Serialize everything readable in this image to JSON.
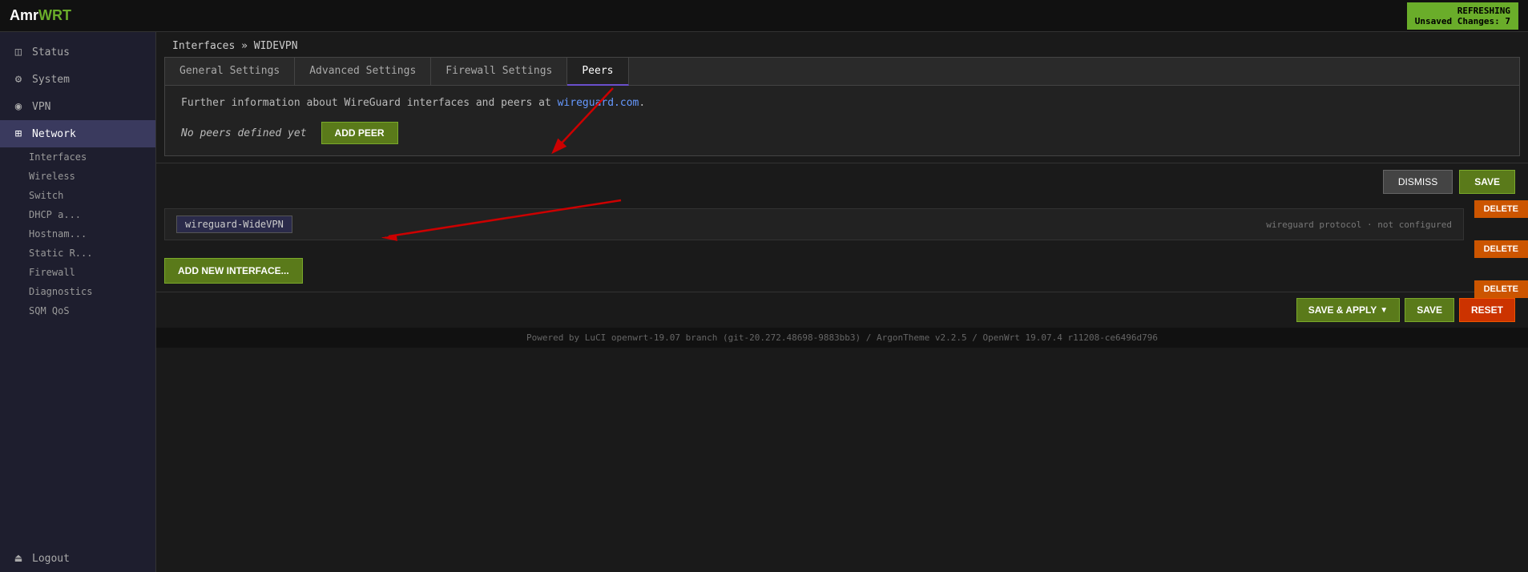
{
  "topbar": {
    "logo_amr": "Amr",
    "logo_wrt": "WRT",
    "refresh_label": "REFRESHING",
    "unsaved_label": "Unsaved Changes: 7"
  },
  "sidebar": {
    "items": [
      {
        "id": "status",
        "label": "Status",
        "icon": "◫"
      },
      {
        "id": "system",
        "label": "System",
        "icon": "⚙"
      },
      {
        "id": "vpn",
        "label": "VPN",
        "icon": "◉"
      },
      {
        "id": "network",
        "label": "Network",
        "icon": "⊞",
        "active": true
      }
    ],
    "sub_items": [
      {
        "id": "interfaces",
        "label": "Interfaces"
      },
      {
        "id": "wireless",
        "label": "Wireless"
      },
      {
        "id": "switch",
        "label": "Switch"
      },
      {
        "id": "dhcp",
        "label": "DHCP a..."
      },
      {
        "id": "hostnames",
        "label": "Hostnam..."
      },
      {
        "id": "static_routes",
        "label": "Static R..."
      },
      {
        "id": "firewall",
        "label": "Firewall"
      },
      {
        "id": "diagnostics",
        "label": "Diagnostics"
      },
      {
        "id": "sqm",
        "label": "SQM QoS"
      }
    ],
    "logout": "Logout"
  },
  "breadcrumb": {
    "parent": "Interfaces",
    "separator": "»",
    "current": "WIDEVPN"
  },
  "tabs": [
    {
      "id": "general",
      "label": "General Settings"
    },
    {
      "id": "advanced",
      "label": "Advanced Settings",
      "active": false
    },
    {
      "id": "firewall",
      "label": "Firewall Settings"
    },
    {
      "id": "peers",
      "label": "Peers",
      "active": true
    }
  ],
  "info_text": {
    "prefix": "Further information about WireGuard interfaces and peers at",
    "link_text": "wireguard.com",
    "link_url": "https://wireguard.com",
    "suffix": "."
  },
  "peers": {
    "no_peers_text": "No peers defined yet",
    "add_peer_label": "ADD PEER"
  },
  "interface_row": {
    "name": "wireguard-WideVPN",
    "delete_labels": [
      "DELETE",
      "DELETE",
      "DELETE"
    ]
  },
  "add_interface_label": "ADD NEW INTERFACE...",
  "bottom_actions": {
    "dismiss_label": "DISMISS",
    "save_label": "SAVE"
  },
  "footer_actions": {
    "save_apply_label": "SAVE & APPLY",
    "save_label": "SAVE",
    "reset_label": "RESET"
  },
  "footer_text": "Powered by LuCI openwrt-19.07 branch (git-20.272.48698-9883bb3) / ArgonTheme v2.2.5 / OpenWrt 19.07.4 r11208-ce6496d796"
}
